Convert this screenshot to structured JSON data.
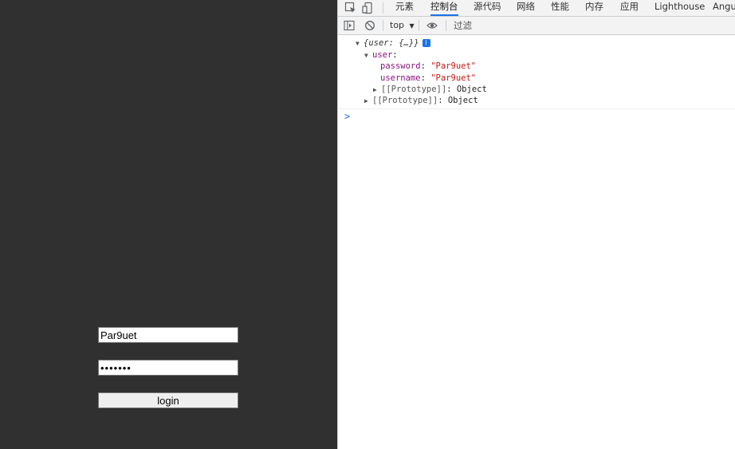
{
  "app": {
    "username_value": "Par9uet",
    "password_value": "•••••••",
    "login_label": "login"
  },
  "devtools": {
    "tabs": [
      "元素",
      "控制台",
      "源代码",
      "网络",
      "性能",
      "内存",
      "应用",
      "Lighthouse",
      "Angu"
    ],
    "active_tab": "控制台",
    "context": "top",
    "filter_placeholder": "过滤"
  },
  "console": {
    "summary": "{user: {…}}",
    "user_key": "user",
    "password_key": "password",
    "password_value": "\"Par9uet\"",
    "username_key": "username",
    "username_value": "\"Par9uet\"",
    "proto_label": "[[Prototype]]",
    "proto_value": "Object",
    "prompt": ">"
  }
}
